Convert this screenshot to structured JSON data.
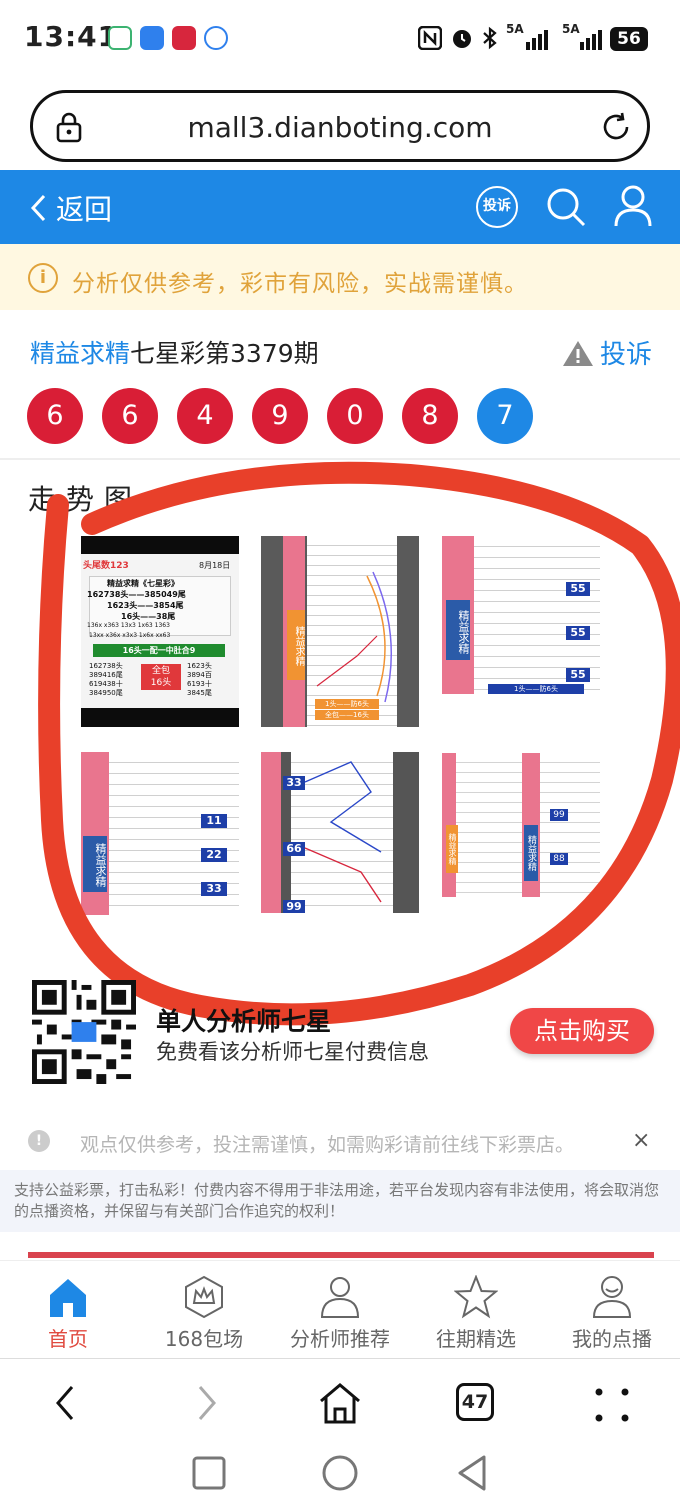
{
  "status": {
    "time": "13:41",
    "net1": "5A",
    "net2": "5A",
    "battery": "56"
  },
  "browser": {
    "url": "mall3.dianboting.com",
    "tab_count": "47"
  },
  "header": {
    "back_label": "返回",
    "complain_badge": "投诉"
  },
  "warning": {
    "text": "分析仅供参考，彩市有风险，实战需谨慎。"
  },
  "title": {
    "highlight": "精益求精",
    "rest": "七星彩第3379期",
    "report_label": "投诉"
  },
  "balls": [
    {
      "n": "6",
      "color": "#D91E36"
    },
    {
      "n": "6",
      "color": "#D91E36"
    },
    {
      "n": "4",
      "color": "#D91E36"
    },
    {
      "n": "9",
      "color": "#D91E36"
    },
    {
      "n": "0",
      "color": "#D91E36"
    },
    {
      "n": "8",
      "color": "#D91E36"
    },
    {
      "n": "7",
      "color": "#1E88E5"
    }
  ],
  "trend": {
    "label": "走势图",
    "thumbs": [
      {
        "name": "thumb-1",
        "top_text": "头尾数123",
        "date": "8月18日",
        "lines": [
          "精益求精《七星彩》",
          "162738头——385049尾",
          "1623头——3854尾",
          "16头——38尾",
          "136x  x363  13x3  1x63  1363",
          "13xx  x36x  x3x3  1x6x  xx63"
        ],
        "green_bar": "16头一配一中肚合9",
        "bottom_left": [
          "162738头",
          "389416尾",
          "619438十",
          "384950尾"
        ],
        "badge": [
          "全包",
          "16头"
        ],
        "bottom_right": [
          "1623头",
          "3894百",
          "6193十",
          "3845尾"
        ]
      },
      {
        "name": "thumb-2",
        "side": "精益求精",
        "badge1": "1头——防6头",
        "badge2": "全包——16头"
      },
      {
        "name": "thumb-3",
        "side": "精益求精",
        "nums": [
          "55",
          "55",
          "55"
        ],
        "bottom": "1头——防6头"
      },
      {
        "name": "thumb-4",
        "side": "精益求精",
        "nums": [
          "11",
          "22",
          "33"
        ]
      },
      {
        "name": "thumb-5",
        "nums": [
          "33",
          "66",
          "99"
        ]
      },
      {
        "name": "thumb-6",
        "side": "精益求精",
        "nums": [
          "99",
          "88"
        ]
      }
    ]
  },
  "promo": {
    "title": "单人分析师七星包月",
    "title_visible": "单人分析师七星",
    "subtitle": "免费看该分析师七星付费信息",
    "buy_label": "点击购买"
  },
  "tip": {
    "text": "观点仅供参考，投注需谨慎，如需购彩请前往线下彩票店。",
    "close": "×"
  },
  "legal": {
    "text": "支持公益彩票，打击私彩！付费内容不得用于非法用途，若平台发现内容有非法使用，将会取消您的点播资格，并保留与有关部门合作追究的权利！"
  },
  "tabs": [
    {
      "label": "首页",
      "icon": "home-icon",
      "active": true
    },
    {
      "label": "168包场",
      "icon": "crown-icon",
      "active": false
    },
    {
      "label": "分析师推荐",
      "icon": "person-icon",
      "active": false
    },
    {
      "label": "往期精选",
      "icon": "star-icon",
      "active": false
    },
    {
      "label": "我的点播",
      "icon": "user-icon",
      "active": false
    }
  ],
  "colors": {
    "brand_blue": "#1E88E5",
    "lottery_red": "#D91E36",
    "highlight_circle": "#E8402A",
    "warn_text": "#E0A33B"
  }
}
